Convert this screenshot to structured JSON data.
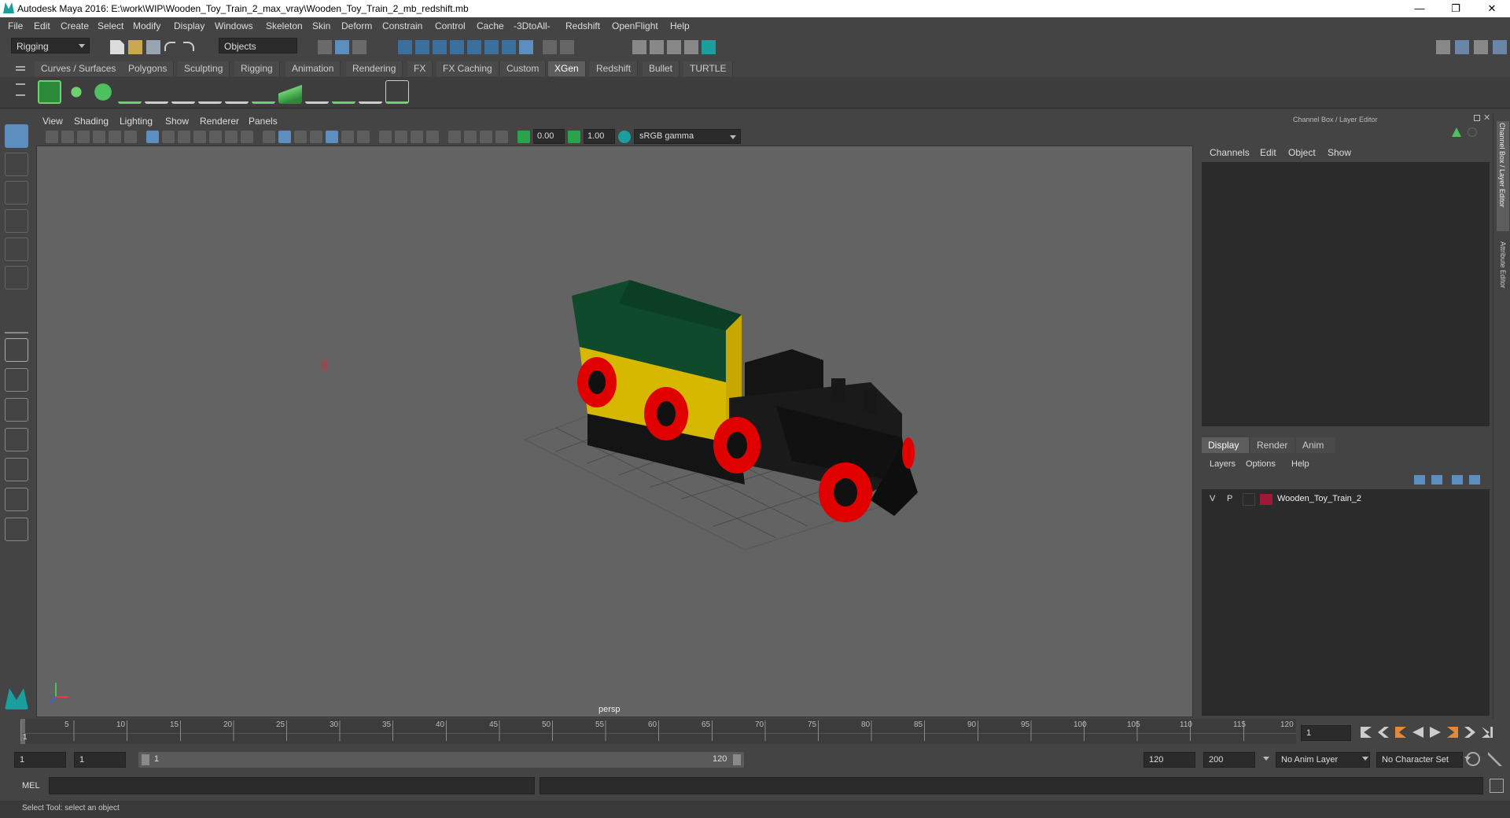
{
  "window": {
    "title": "Autodesk Maya 2016: E:\\work\\WIP\\Wooden_Toy_Train_2_max_vray\\Wooden_Toy_Train_2_mb_redshift.mb",
    "minimize": "—",
    "restore": "❐",
    "close": "✕"
  },
  "menubar": [
    "File",
    "Edit",
    "Create",
    "Select",
    "Modify",
    "Display",
    "Windows",
    "Skeleton",
    "Skin",
    "Deform",
    "Constrain",
    "Control",
    "Cache",
    "-3DtoAll-",
    "Redshift",
    "OpenFlight",
    "Help"
  ],
  "statusline": {
    "mode": "Rigging",
    "selection_mask": "Objects"
  },
  "shelf_tabs": [
    "Curves / Surfaces",
    "Polygons",
    "Sculpting",
    "Rigging",
    "Animation",
    "Rendering",
    "FX",
    "FX Caching",
    "Custom",
    "XGen",
    "Redshift",
    "Bullet",
    "TURTLE"
  ],
  "shelf_active": "XGen",
  "viewport": {
    "menus": [
      "View",
      "Shading",
      "Lighting",
      "Show",
      "Renderer",
      "Panels"
    ],
    "exposure": "0.00",
    "gamma": "1.00",
    "color_space": "sRGB gamma",
    "camera_label": "persp"
  },
  "channelbox": {
    "header": "Channel Box / Layer Editor",
    "menus": [
      "Channels",
      "Edit",
      "Object",
      "Show"
    ],
    "layer_tabs": [
      "Display",
      "Render",
      "Anim"
    ],
    "layer_menus": [
      "Layers",
      "Options",
      "Help"
    ],
    "layers": [
      {
        "v": "V",
        "p": "P",
        "color": "#a01838",
        "name": "Wooden_Toy_Train_2"
      }
    ]
  },
  "sidebar_tabs": {
    "channel_box": "Channel Box / Layer Editor",
    "attribute_editor": "Attribute Editor"
  },
  "timeline": {
    "ticks": [
      "1",
      "5",
      "10",
      "15",
      "20",
      "25",
      "30",
      "35",
      "40",
      "45",
      "50",
      "55",
      "60",
      "65",
      "70",
      "75",
      "80",
      "85",
      "90",
      "95",
      "100",
      "105",
      "110",
      "115",
      "120"
    ],
    "current_frame": "1"
  },
  "range": {
    "start": "1",
    "playback_start": "1",
    "slider_start": "1",
    "slider_end": "120",
    "playback_end": "120",
    "end": "200",
    "anim_layer": "No Anim Layer",
    "character_set": "No Character Set"
  },
  "cmdline": {
    "lang": "MEL"
  },
  "helpline": {
    "text": "Select Tool: select an object"
  },
  "colors": {
    "accent": "#5c8fbf",
    "train_green": "#0f4a2c",
    "train_yellow": "#d7b800",
    "wheel_red": "#e00000",
    "body_black": "#141414"
  }
}
